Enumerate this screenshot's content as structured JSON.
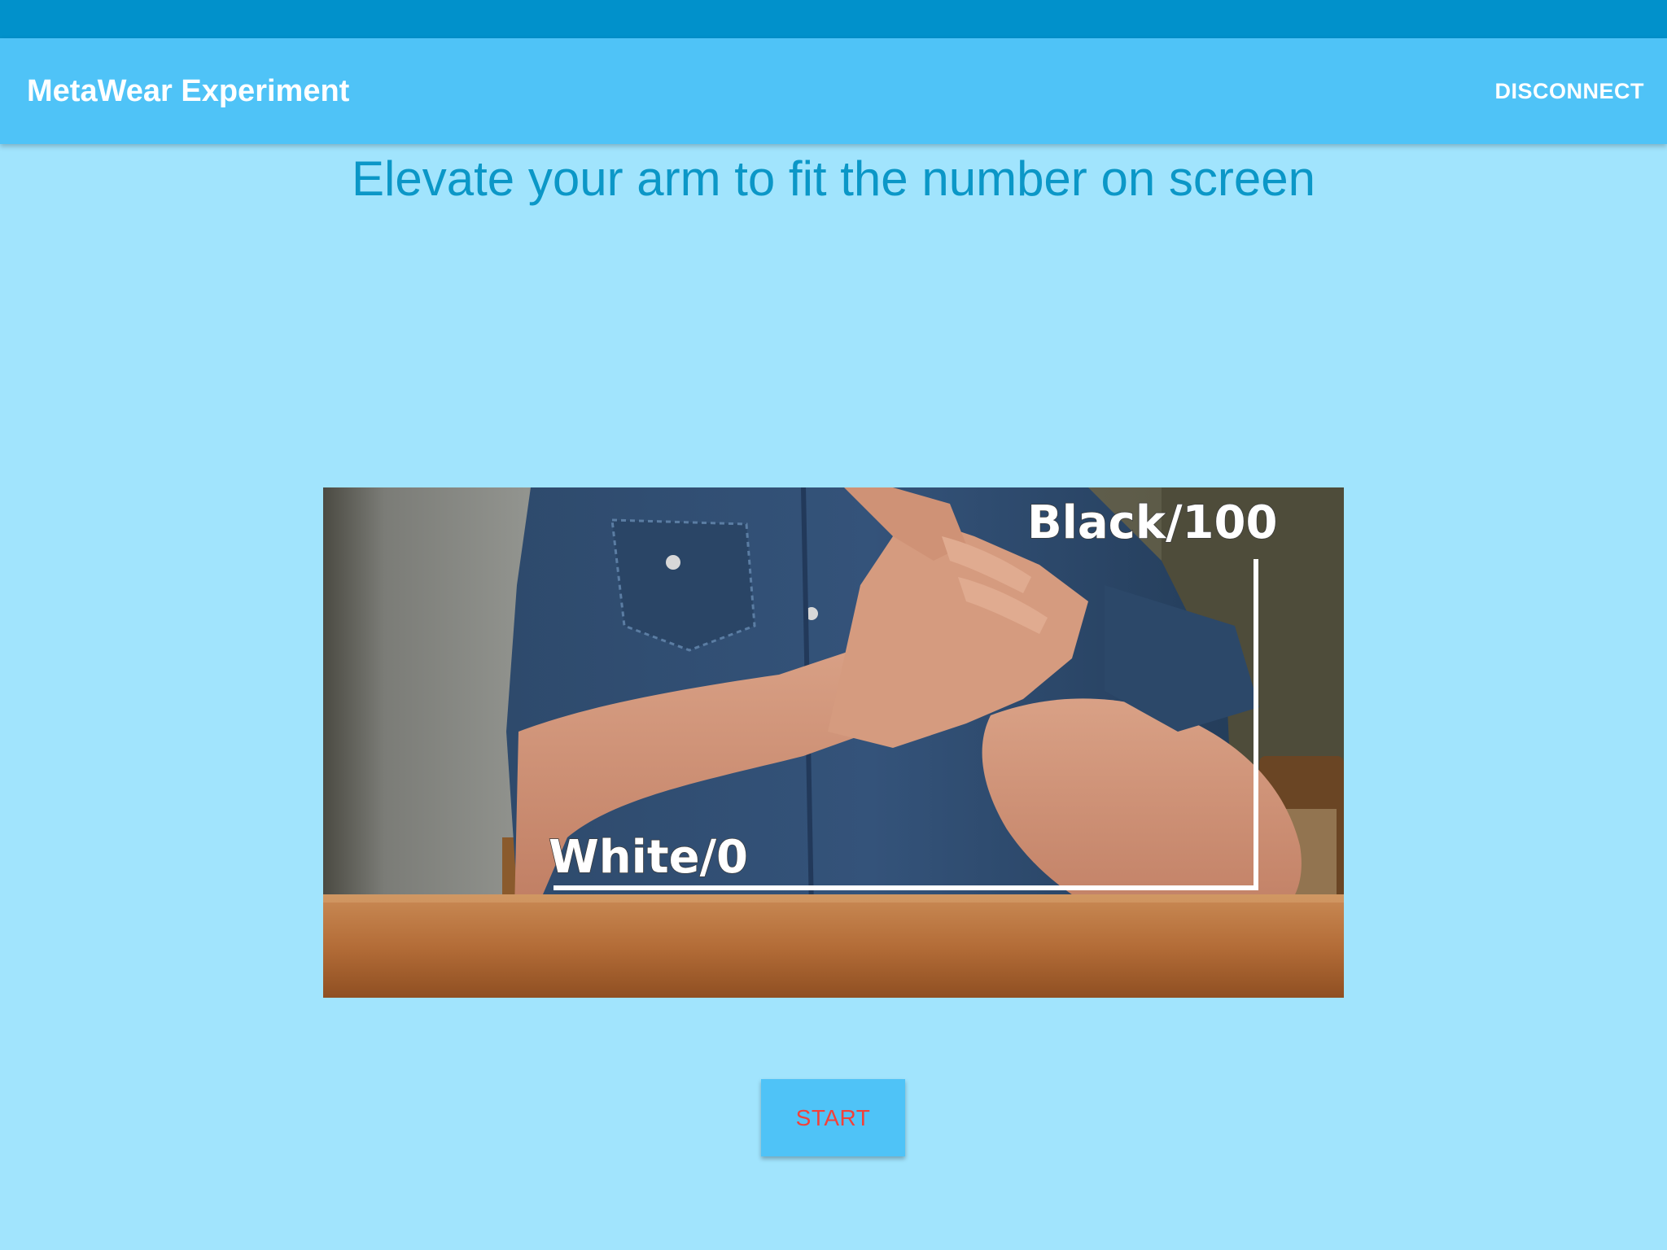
{
  "app_bar": {
    "title": "MetaWear Experiment",
    "action_label": "DISCONNECT"
  },
  "main": {
    "instruction": "Elevate your arm to fit the number on screen",
    "illustration": {
      "top_label": "Black/100",
      "bottom_label": "White/0"
    },
    "start_label": "START"
  },
  "colors": {
    "status_bar": "#0191cb",
    "app_bar": "#4fc3f7",
    "background": "#a1e4fd",
    "instruction_text": "#0b97c7",
    "start_text": "#f2413a"
  }
}
